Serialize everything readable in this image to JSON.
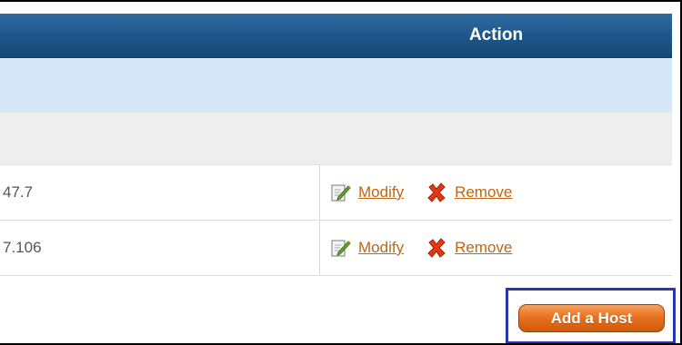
{
  "table": {
    "header": {
      "action_label": "Action"
    },
    "rows": [
      {
        "ip": "47.7",
        "modify_label": "Modify",
        "remove_label": "Remove"
      },
      {
        "ip": "7.106",
        "modify_label": "Modify",
        "remove_label": "Remove"
      }
    ]
  },
  "footer": {
    "add_host_label": "Add a Host"
  },
  "icons": {
    "edit": "edit-pencil-icon",
    "remove": "remove-x-icon"
  },
  "colors": {
    "header_bg": "#1f578a",
    "link": "#c4650f",
    "button": "#e8721f",
    "highlight": "#2a35b0"
  }
}
